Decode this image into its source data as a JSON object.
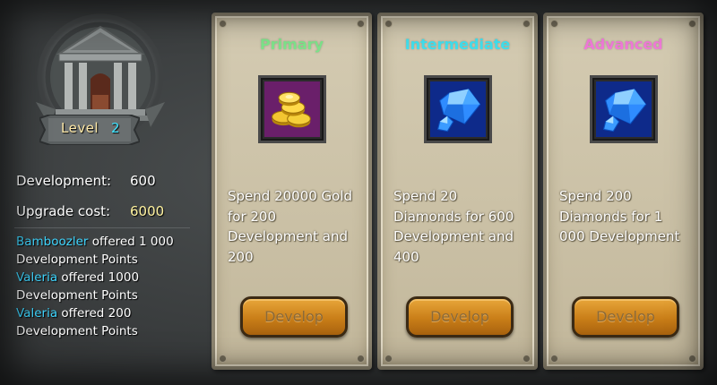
{
  "building": {
    "level_label": "Level",
    "level_value": "2"
  },
  "stats": {
    "development_label": "Development:",
    "development_value": "600",
    "upgrade_label": "Upgrade cost:",
    "upgrade_value": "6000",
    "upgrade_color": "#fff3a0"
  },
  "log": [
    {
      "player": "Bamboozler",
      "message": " offered 1 000 Development Points"
    },
    {
      "player": "Valeria",
      "message": " offered 1000 Development Points"
    },
    {
      "player": "Valeria",
      "message": " offered 200 Development Points"
    }
  ],
  "cards": [
    {
      "title": "Primary",
      "title_color": "#7de38a",
      "icon": "gold-coins-icon",
      "description": "Spend 20000 Gold for 200 Development and 200",
      "button": "Develop"
    },
    {
      "title": "Intermediate",
      "title_color": "#3fe0ee",
      "icon": "diamond-icon",
      "description": "Spend 20 Diamonds for 600 Development and 400",
      "button": "Develop"
    },
    {
      "title": "Advanced",
      "title_color": "#f07ad8",
      "icon": "diamond-icon",
      "description": "Spend 200 Diamonds for 1 000 Development",
      "button": "Develop"
    }
  ],
  "colors": {
    "accent_cyan": "#3fd6ff",
    "button_orange": "#c97e18",
    "card_bg": "#cac0a5"
  }
}
